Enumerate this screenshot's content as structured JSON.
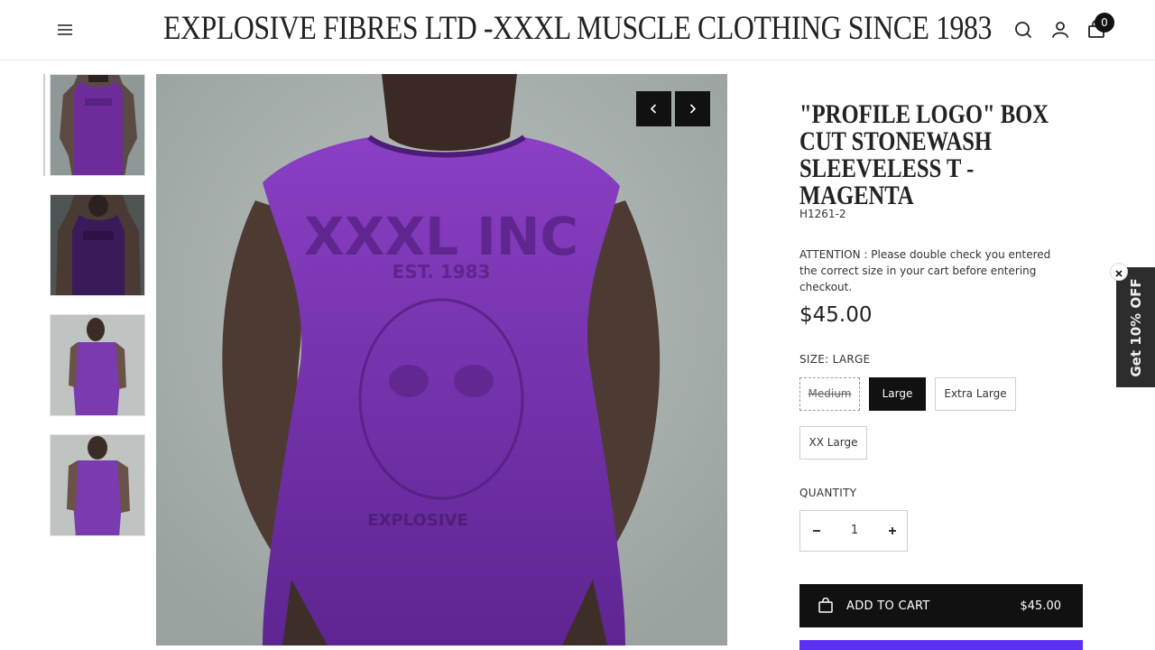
{
  "header": {
    "store_title": "EXPLOSIVE FIBRES LTD -XXXL MUSCLE CLOTHING SINCE 1983",
    "cart_count": "0",
    "icons": [
      "menu-icon",
      "search-icon",
      "account-icon",
      "cart-icon"
    ]
  },
  "gallery": {
    "thumbnails": [
      {
        "name": "back view"
      },
      {
        "name": "back view dark"
      },
      {
        "name": "side view"
      },
      {
        "name": "front view"
      }
    ],
    "main_logo_text": "XXXL INC",
    "main_est_text": "EST. 1983",
    "main_bottom_text": "EXPLOSIVE"
  },
  "product": {
    "title": "\"PROFILE LOGO\" BOX CUT STONEWASH SLEEVELESS T - MAGENTA",
    "sku": "H1261-2",
    "attention": "ATTENTION : Please double check you entered the correct size in your cart before entering checkout.",
    "price": "$45.00",
    "size_label": "SIZE: LARGE",
    "sizes": [
      {
        "label": "Medium",
        "state": "unavailable"
      },
      {
        "label": "Large",
        "state": "selected"
      },
      {
        "label": "Extra Large",
        "state": "available"
      },
      {
        "label": "XX Large",
        "state": "available"
      }
    ],
    "quantity_label": "QUANTITY",
    "quantity": "1",
    "add_to_cart_label": "ADD TO CART",
    "add_to_cart_price": "$45.00"
  },
  "promo": {
    "discount_text": "Get 10% OFF"
  },
  "colors": {
    "accent_black": "#111111",
    "shirt_purple": "#6a2a9e",
    "pay_button": "#5a31f4",
    "promo_tab": "#2d2d2d"
  }
}
